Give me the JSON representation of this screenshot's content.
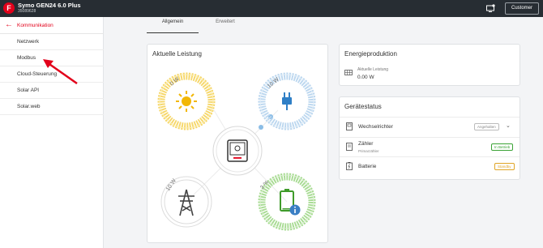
{
  "header": {
    "device_title": "Symo GEN24 6.0 Plus",
    "device_serial": "35089628",
    "customer_label": "Customer",
    "icons": {
      "logo": "fronius-logo",
      "notifications": "monitor-notification-icon"
    }
  },
  "sidebar": {
    "back_label": "Kommunikation",
    "items": [
      {
        "label": "Netzwerk"
      },
      {
        "label": "Modbus"
      },
      {
        "label": "Cloud-Steuerung"
      },
      {
        "label": "Solar API"
      },
      {
        "label": "Solar.web"
      }
    ]
  },
  "tabs": [
    {
      "label": "Allgemein",
      "active": true
    },
    {
      "label": "Erweitert",
      "active": false
    }
  ],
  "aktuelle_leistung": {
    "title": "Aktuelle Leistung",
    "nodes": {
      "pv": {
        "value": "0 W",
        "icon": "sun-icon",
        "color": "#f5c518"
      },
      "load": {
        "value": "10 W",
        "icon": "plug-icon",
        "color": "#8bbde6"
      },
      "grid": {
        "value": "10 W",
        "icon": "power-tower-icon",
        "color": "#cfcfcf"
      },
      "battery": {
        "value": "3 %",
        "icon": "battery-icon",
        "color": "#6cc04a",
        "level": 0.03
      }
    }
  },
  "energieproduktion": {
    "title": "Energieproduktion",
    "label": "Aktuelle Leistung",
    "value": "0.00 W"
  },
  "geraetestatus": {
    "title": "Gerätestatus",
    "devices": [
      {
        "name": "Wechselrichter",
        "sub": "",
        "status": "Angehalten",
        "status_color": "#888888"
      },
      {
        "name": "Zähler",
        "sub": "Primarzähler",
        "status": "In Betrieb",
        "status_color": "#3aa335"
      },
      {
        "name": "Batterie",
        "sub": "",
        "status": "Standby",
        "status_color": "#e0a526"
      }
    ]
  }
}
